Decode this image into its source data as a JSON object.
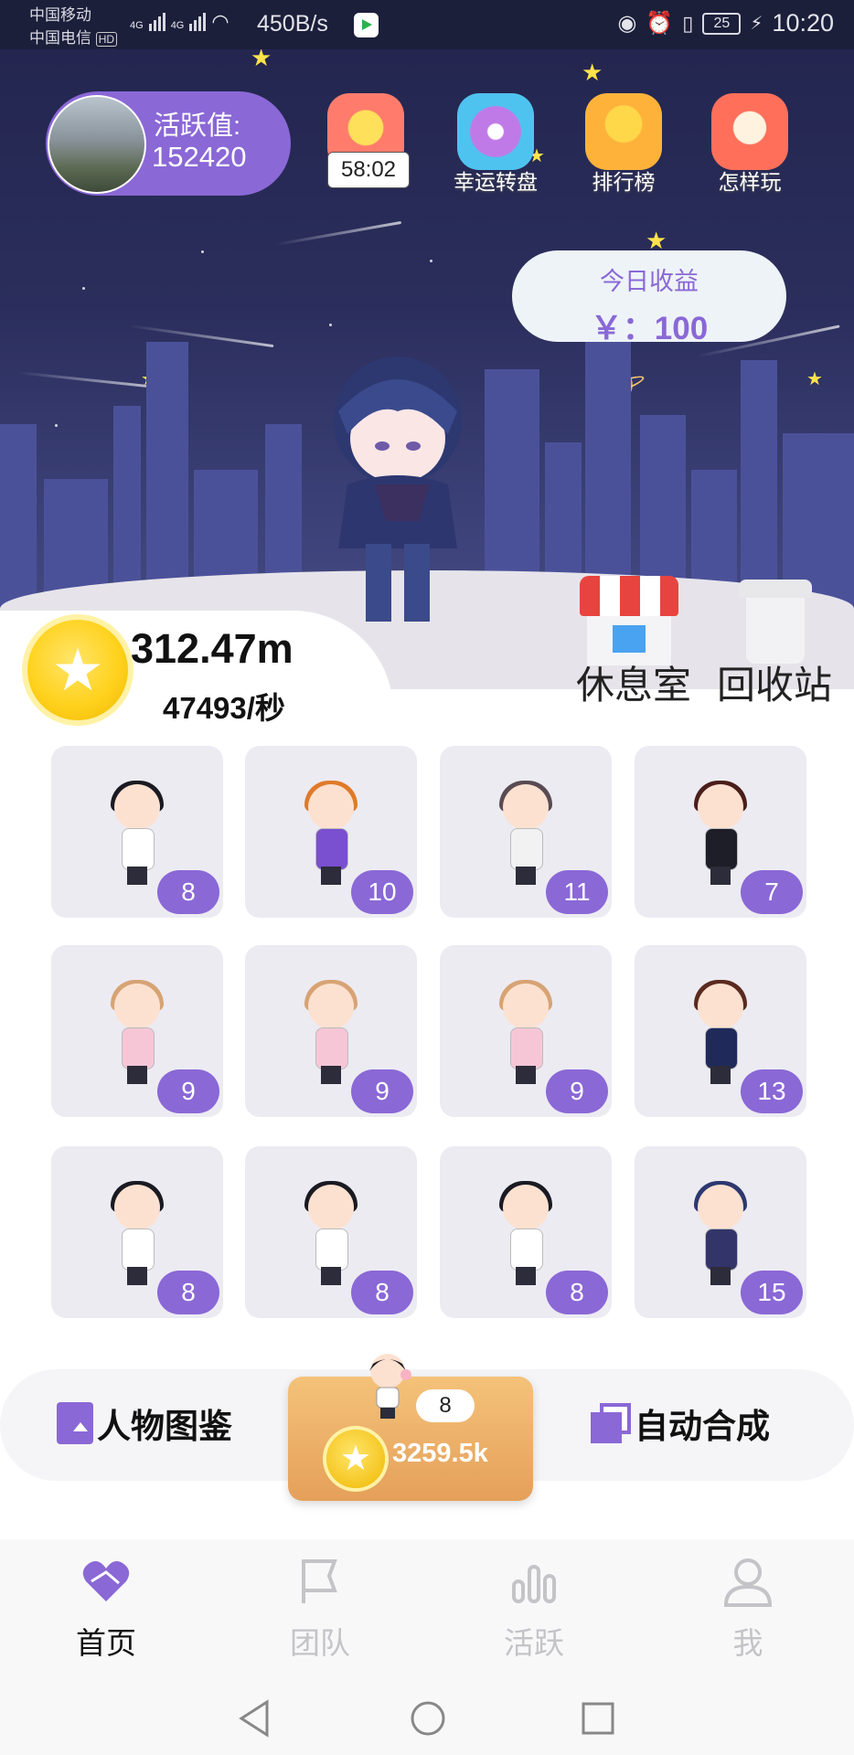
{
  "status_bar": {
    "carrier1": "中国移动",
    "carrier2": "中国电信",
    "hd": "HD",
    "net1": "4G",
    "net2": "4G",
    "speed": "450B/s",
    "battery": "25",
    "time": "10:20"
  },
  "profile": {
    "label": "活跃值:",
    "value": "152420"
  },
  "toolbar": {
    "timer": "58:02",
    "lucky_wheel": "幸运转盘",
    "ranking": "排行榜",
    "how_to_play": "怎样玩"
  },
  "earnings": {
    "title": "今日收益",
    "value": "￥：100"
  },
  "balance": {
    "coins": "312.47m",
    "rate": "47493/秒"
  },
  "rooms": {
    "lounge": "休息室",
    "recycle": "回收站"
  },
  "grid": [
    {
      "level": "8",
      "character": "boy-icecream"
    },
    {
      "level": "10",
      "character": "girl-scooter"
    },
    {
      "level": "11",
      "character": "girl-longhair"
    },
    {
      "level": "7",
      "character": "boy-suit"
    },
    {
      "level": "9",
      "character": "girl-pinkdress"
    },
    {
      "level": "9",
      "character": "girl-pinkdress"
    },
    {
      "level": "9",
      "character": "girl-pinkdress"
    },
    {
      "level": "13",
      "character": "man-navysuit"
    },
    {
      "level": "8",
      "character": "boy-icecream"
    },
    {
      "level": "8",
      "character": "boy-icecream"
    },
    {
      "level": "8",
      "character": "boy-icecream"
    },
    {
      "level": "15",
      "character": "blue-hair-hero"
    }
  ],
  "actions": {
    "catalog": "人物图鉴",
    "auto_merge": "自动合成",
    "buy_level": "8",
    "buy_price": "3259.5k"
  },
  "tabs": [
    {
      "label": "首页",
      "active": true
    },
    {
      "label": "团队",
      "active": false
    },
    {
      "label": "活跃",
      "active": false
    },
    {
      "label": "我",
      "active": false
    }
  ],
  "colors": {
    "accent": "#8a68d6",
    "night_sky": "#23264f",
    "coin": "#ffd21e"
  }
}
